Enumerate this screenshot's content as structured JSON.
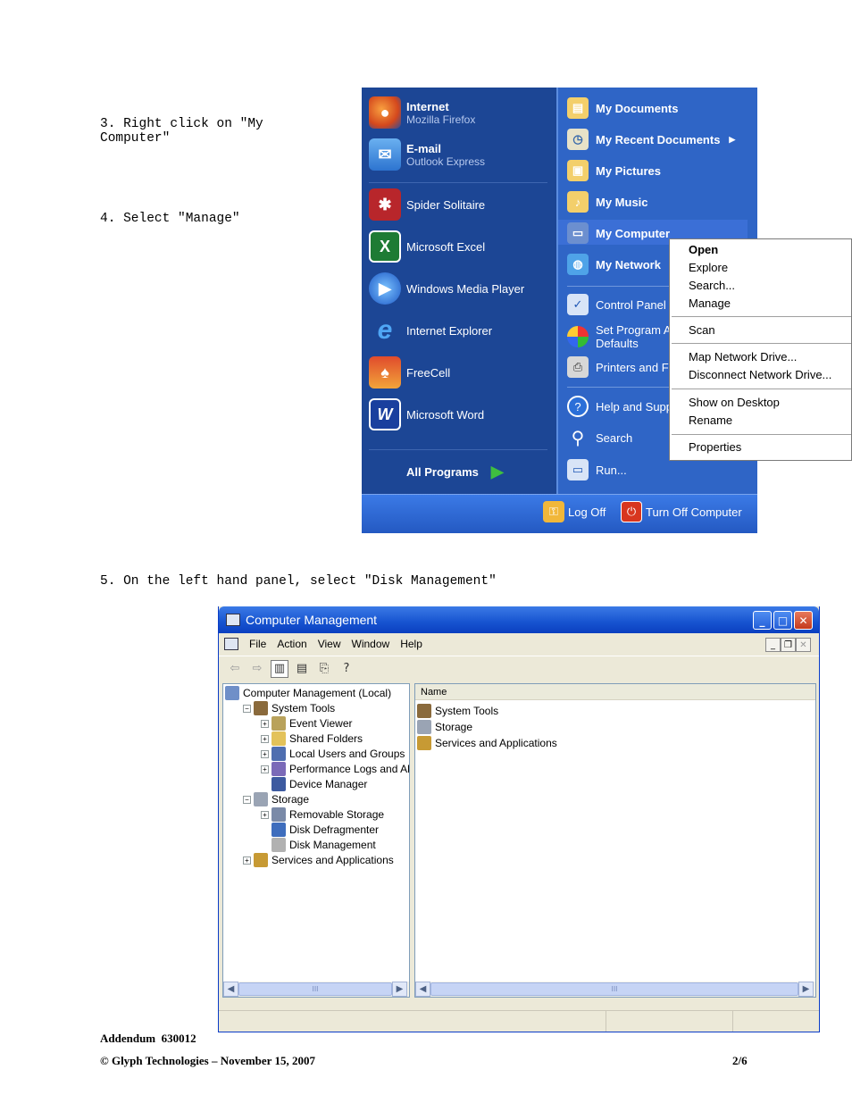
{
  "steps": {
    "step3": "3. Right click on \"My\nComputer\"",
    "step4": "4. Select \"Manage\"",
    "step5": "5. On the left hand panel, select \"Disk Management\""
  },
  "start_menu": {
    "pinned": [
      {
        "title": "Internet",
        "sub": "Mozilla Firefox",
        "icon": "firefox-icon"
      },
      {
        "title": "E-mail",
        "sub": "Outlook Express",
        "icon": "outlook-express-icon"
      }
    ],
    "recent": [
      {
        "label": "Spider Solitaire",
        "icon": "spider-solitaire-icon"
      },
      {
        "label": "Microsoft Excel",
        "icon": "excel-icon"
      },
      {
        "label": "Windows Media Player",
        "icon": "media-player-icon"
      },
      {
        "label": "Internet Explorer",
        "icon": "internet-explorer-icon"
      },
      {
        "label": "FreeCell",
        "icon": "freecell-icon"
      },
      {
        "label": "Microsoft Word",
        "icon": "word-icon"
      }
    ],
    "all_programs": "All Programs",
    "right": {
      "my_documents": "My Documents",
      "my_recent_documents": "My Recent Documents",
      "my_pictures": "My Pictures",
      "my_music": "My Music",
      "my_computer": "My Computer",
      "my_network": "My Network",
      "control_panel": "Control Panel",
      "set_program_1": "Set Program A",
      "set_program_2": "Defaults",
      "printers": "Printers and Fa",
      "help": "Help and Supp",
      "search": "Search",
      "run": "Run..."
    },
    "log_off": "Log Off",
    "turn_off": "Turn Off Computer"
  },
  "context_menu": {
    "open": "Open",
    "explore": "Explore",
    "search": "Search...",
    "manage": "Manage",
    "scan": "Scan",
    "map_drive": "Map Network Drive...",
    "disconnect_drive": "Disconnect Network Drive...",
    "show_desktop": "Show on Desktop",
    "rename": "Rename",
    "properties": "Properties"
  },
  "cm_window": {
    "title": "Computer Management",
    "menu": [
      "File",
      "Action",
      "View",
      "Window",
      "Help"
    ],
    "tree": [
      {
        "label": "Computer Management (Local)",
        "level": 0,
        "expander": ""
      },
      {
        "label": "System Tools",
        "level": 1,
        "expander": "−"
      },
      {
        "label": "Event Viewer",
        "level": 2,
        "expander": "+"
      },
      {
        "label": "Shared Folders",
        "level": 2,
        "expander": "+"
      },
      {
        "label": "Local Users and Groups",
        "level": 2,
        "expander": "+"
      },
      {
        "label": "Performance Logs and Alerts",
        "level": 2,
        "expander": "+"
      },
      {
        "label": "Device Manager",
        "level": 2,
        "expander": ""
      },
      {
        "label": "Storage",
        "level": 1,
        "expander": "−"
      },
      {
        "label": "Removable Storage",
        "level": 2,
        "expander": "+"
      },
      {
        "label": "Disk Defragmenter",
        "level": 2,
        "expander": ""
      },
      {
        "label": "Disk Management",
        "level": 2,
        "expander": ""
      },
      {
        "label": "Services and Applications",
        "level": 1,
        "expander": "+"
      }
    ],
    "column_name": "Name",
    "list": [
      "System Tools",
      "Storage",
      "Services and Applications"
    ]
  },
  "footer": {
    "addendum": "Addendum  630012",
    "copyright": "© Glyph Technologies – November 15, 2007",
    "page": "2/6"
  }
}
